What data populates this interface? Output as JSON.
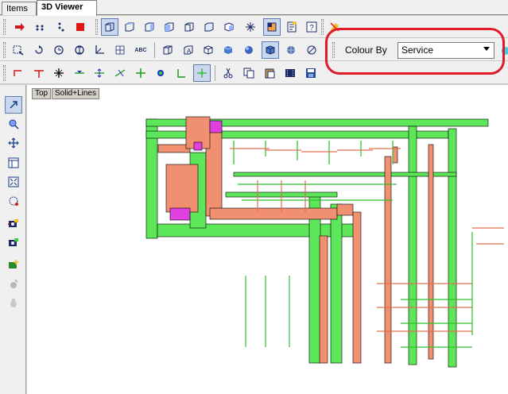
{
  "tabs": {
    "items": "Items",
    "viewer": "3D Viewer"
  },
  "toolbar": {
    "colour_by_label": "Colour By",
    "colour_by_value": "Service",
    "text_tool_label": "ABC"
  },
  "viewport": {
    "view_label": "Top",
    "mode_label": "Solid+Lines"
  },
  "icons": {
    "row1": [
      "arrow-right-icon",
      "dots-icon",
      "dots-vertical-icon",
      "stop-icon",
      "cube-front-icon",
      "cube-top-icon",
      "cube-right-icon",
      "cube-left-icon",
      "cube-back-icon",
      "cube-iso-icon",
      "sparkle-icon",
      "layer-icon",
      "properties-icon",
      "help-icon",
      "erase-icon"
    ],
    "row2": [
      "zoom-window-icon",
      "rotate-icon",
      "clock-icon",
      "pan-icon",
      "axis-icon",
      "grid-icon",
      "text-icon",
      "box-wire-icon",
      "box-hidden-icon",
      "box-solid-icon",
      "cube-blue-icon",
      "sphere-icon",
      "cube-shaded-icon",
      "sphere-shaded-icon",
      "no-render-icon"
    ],
    "row3": [
      "elbow-icon",
      "tee-icon",
      "cross-icon",
      "eye-icon",
      "split-icon",
      "line-cut-icon",
      "plus-icon",
      "target-icon",
      "corner-icon",
      "snap-icon",
      "scissors-icon",
      "copy-icon",
      "paste-icon",
      "film-icon",
      "save-view-icon"
    ],
    "left": [
      "select-arrow-icon",
      "zoom-icon",
      "move-icon",
      "window-icon",
      "fit-icon",
      "orbit-icon",
      "camera-icon",
      "camera-alt-icon",
      "add-component-icon",
      "gear-disabled-icon",
      "gear-disabled-alt-icon"
    ]
  },
  "colors": {
    "highlight": "#e0192b",
    "duct_green": "#5ee65a",
    "duct_orange": "#f09070",
    "duct_magenta": "#e040e0",
    "pipe_green": "#2fbf2a",
    "pipe_orange": "#e07050"
  }
}
